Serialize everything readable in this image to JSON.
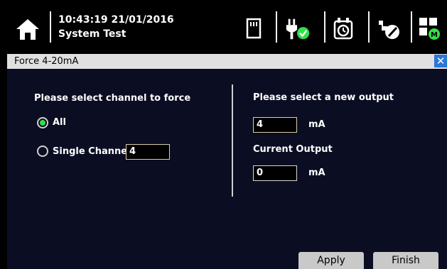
{
  "status_bar": {
    "datetime": "10:43:19 21/01/2016",
    "screen_title": "System Test",
    "icons": [
      "home-icon",
      "memory-card-icon",
      "power-plug-ok-icon",
      "alarm-clock-icon",
      "wrench-icon",
      "menu-grid-icon"
    ],
    "ok_color": "#2ee24a"
  },
  "dialog": {
    "title": "Force 4-20mA",
    "close_label": "✕"
  },
  "channel_section": {
    "heading": "Please select channel to force",
    "options": [
      {
        "label": "All",
        "selected": true
      },
      {
        "label": "Single Channel",
        "selected": false
      }
    ],
    "single_channel_value": "4"
  },
  "output_section": {
    "heading": "Please select a new output",
    "new_output_value": "4",
    "new_output_unit": "mA",
    "current_heading": "Current Output",
    "current_output_value": "0",
    "current_output_unit": "mA"
  },
  "buttons": {
    "apply": "Apply",
    "finish": "Finish"
  }
}
